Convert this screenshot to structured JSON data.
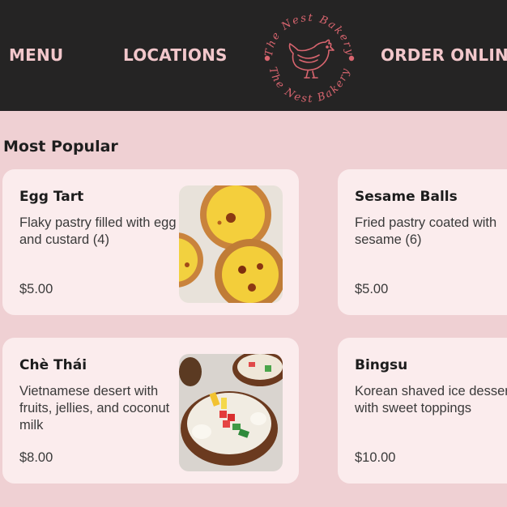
{
  "nav": {
    "menu": "MENU",
    "locations": "LOCATIONS",
    "order": "ORDER ONLINE"
  },
  "logo": {
    "brand_top": "The Nest Bakery",
    "brand_bottom": "The Nest Bakery",
    "icon": "hen-icon"
  },
  "section": {
    "title": "Most Popular"
  },
  "items": [
    {
      "name": "Egg Tart",
      "desc": "Flaky pastry filled with egg and custard (4)",
      "price": "$5.00",
      "image": "egg-tarts-photo"
    },
    {
      "name": "Sesame Balls",
      "desc": "Fried pastry coated with sesame (6)",
      "price": "$5.00"
    },
    {
      "name": "Chè Thái",
      "desc": "Vietnamese desert with fruits, jellies, and coconut milk",
      "price": "$8.00",
      "image": "che-thai-photo"
    },
    {
      "name": "Bingsu",
      "desc": "Korean shaved ice dessert with sweet toppings",
      "price": "$10.00"
    }
  ],
  "colors": {
    "header_bg": "#252424",
    "nav_text": "#f2c7cb",
    "page_bg": "#efd0d3",
    "card_bg": "#fbeced",
    "logo_accent": "#d9656f"
  }
}
